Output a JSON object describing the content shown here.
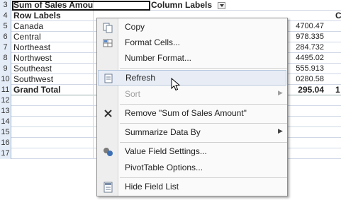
{
  "sheet": {
    "rows": [
      {
        "num": "3",
        "a": "Sum of Sales Amount",
        "b": "Column Labels"
      },
      {
        "num": "4",
        "a": "Row Labels",
        "b": ""
      },
      {
        "num": "5",
        "a": "Canada",
        "val": "4700.47"
      },
      {
        "num": "6",
        "a": "Central",
        "val": "978.335"
      },
      {
        "num": "7",
        "a": "Northeast",
        "val": "284.732"
      },
      {
        "num": "8",
        "a": "Northwest",
        "val": "4495.02"
      },
      {
        "num": "9",
        "a": "Southeast",
        "val": "555.913"
      },
      {
        "num": "10",
        "a": "Southwest",
        "val": "0280.58"
      },
      {
        "num": "11",
        "a": "Grand Total",
        "val": "295.04"
      },
      {
        "num": "12",
        "a": ""
      },
      {
        "num": "13",
        "a": ""
      },
      {
        "num": "14",
        "a": ""
      },
      {
        "num": "15",
        "a": ""
      },
      {
        "num": "16",
        "a": ""
      },
      {
        "num": "17",
        "a": ""
      }
    ],
    "edge_right_row4": "Cl",
    "edge_right_row11": "1"
  },
  "menu": {
    "copy": "Copy",
    "format_cells": "Format Cells...",
    "number_format": "Number Format...",
    "refresh": "Refresh",
    "sort": "Sort",
    "remove": "Remove \"Sum of Sales Amount\"",
    "summarize": "Summarize Data By",
    "value_field": "Value Field Settings...",
    "pivot_options": "PivotTable Options...",
    "hide_field": "Hide Field List"
  }
}
